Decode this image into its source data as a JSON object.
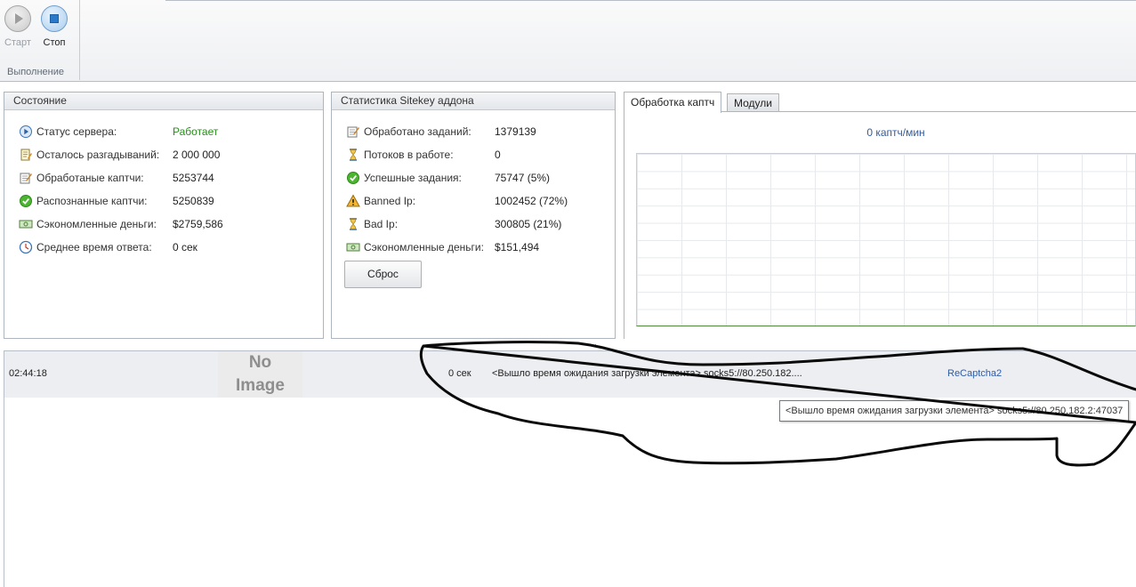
{
  "ribbon": {
    "start_label": "Старт",
    "stop_label": "Стоп",
    "group_label": "Выполнение"
  },
  "state_panel": {
    "title": "Состояние",
    "rows": [
      {
        "label": "Статус сервера:",
        "value": "Работает",
        "icon": "play-circle-icon"
      },
      {
        "label": "Осталось разгадываний:",
        "value": "2 000 000",
        "icon": "notepad-icon"
      },
      {
        "label": "Обработаные каптчи:",
        "value": "5253744",
        "icon": "edit-document-icon"
      },
      {
        "label": "Распознанные каптчи:",
        "value": "5250839",
        "icon": "check-circle-icon"
      },
      {
        "label": "Сэкономленные деньги:",
        "value": "$2759,586",
        "icon": "money-icon"
      },
      {
        "label": "Среднее время ответа:",
        "value": "0 сек",
        "icon": "clock-icon"
      }
    ],
    "status_color": "#2b8a1e"
  },
  "sitekey_panel": {
    "title": "Статистика Sitekey аддона",
    "rows": [
      {
        "label": "Обработано заданий:",
        "value": "1379139",
        "icon": "edit-document-icon"
      },
      {
        "label": "Потоков в работе:",
        "value": "0",
        "icon": "hourglass-icon"
      },
      {
        "label": "Успешные задания:",
        "value": "75747 (5%)",
        "icon": "check-circle-icon"
      },
      {
        "label": "Banned Ip:",
        "value": "1002452 (72%)",
        "icon": "warning-icon"
      },
      {
        "label": "Bad Ip:",
        "value": "300805 (21%)",
        "icon": "hourglass-icon"
      },
      {
        "label": "Сэкономленные деньги:",
        "value": "$151,494",
        "icon": "money-icon"
      }
    ],
    "reset_label": "Сброс"
  },
  "graph_tabs": {
    "tabs": [
      "Обработка каптч",
      "Модули"
    ],
    "active_tab": "Обработка каптч",
    "rate_text": "0 каптч/мин"
  },
  "log": {
    "row": {
      "time": "02:44:18",
      "image_placeholder": "No Image",
      "duration": "0 сек",
      "message": "<Вышло время ожидания загрузки элемента>  socks5://80.250.182....",
      "type": "ReCaptcha2"
    },
    "tooltip": "<Вышло время ожидания загрузки элемента>  socks5://80.250.182.2:47037"
  },
  "colors": {
    "accent_link": "#2e5ca8",
    "status_ok": "#2b8a1e",
    "panel_border": "#adb5bf"
  }
}
